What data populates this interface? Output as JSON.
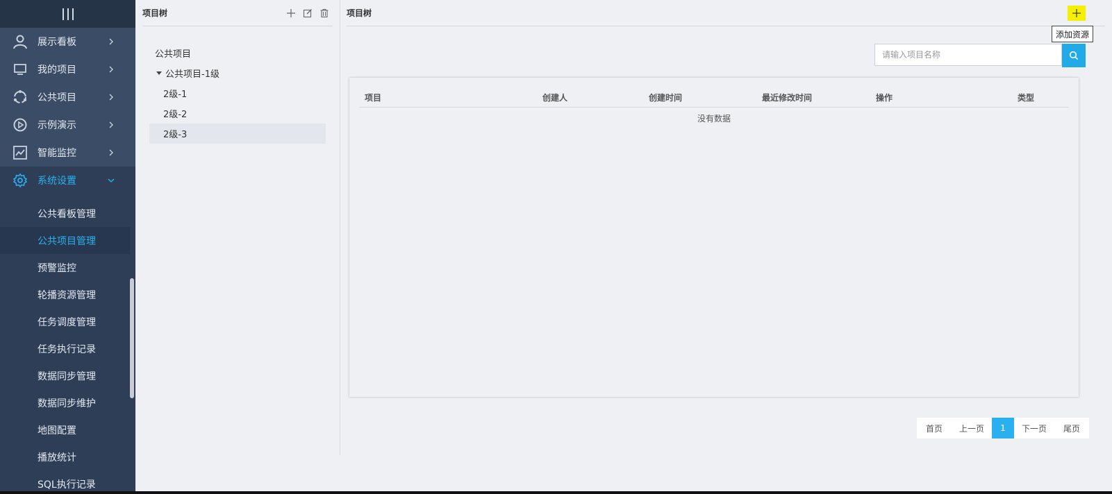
{
  "sidebar": {
    "menu": [
      {
        "label": "展示看板",
        "icon": "user-icon"
      },
      {
        "label": "我的项目",
        "icon": "monitor-icon"
      },
      {
        "label": "公共项目",
        "icon": "circle-dots-icon"
      },
      {
        "label": "示例演示",
        "icon": "play-circle-icon"
      },
      {
        "label": "智能监控",
        "icon": "line-chart-icon"
      },
      {
        "label": "系统设置",
        "icon": "gear-icon"
      }
    ],
    "submenu": [
      "公共看板管理",
      "公共项目管理",
      "预警监控",
      "轮播资源管理",
      "任务调度管理",
      "任务执行记录",
      "数据同步管理",
      "数据同步维护",
      "地图配置",
      "播放统计",
      "SQL执行记录"
    ],
    "active_submenu": 1,
    "colors": {
      "bg": "#2e3e57",
      "accent": "#2ab0ef"
    }
  },
  "tree_panel": {
    "title": "项目树",
    "nodes": [
      "公共项目",
      "公共项目-1级",
      "2级-1",
      "2级-2",
      "2级-3"
    ]
  },
  "main": {
    "title": "项目树",
    "add_tooltip": "添加资源",
    "search_placeholder": "请输入项目名称",
    "columns": [
      "项目",
      "创建人",
      "创建时间",
      "最近修改时间",
      "操作",
      "类型"
    ],
    "empty_text": "没有数据",
    "pager": {
      "first": "首页",
      "prev": "上一页",
      "current": "1",
      "next": "下一页",
      "last": "尾页"
    }
  }
}
